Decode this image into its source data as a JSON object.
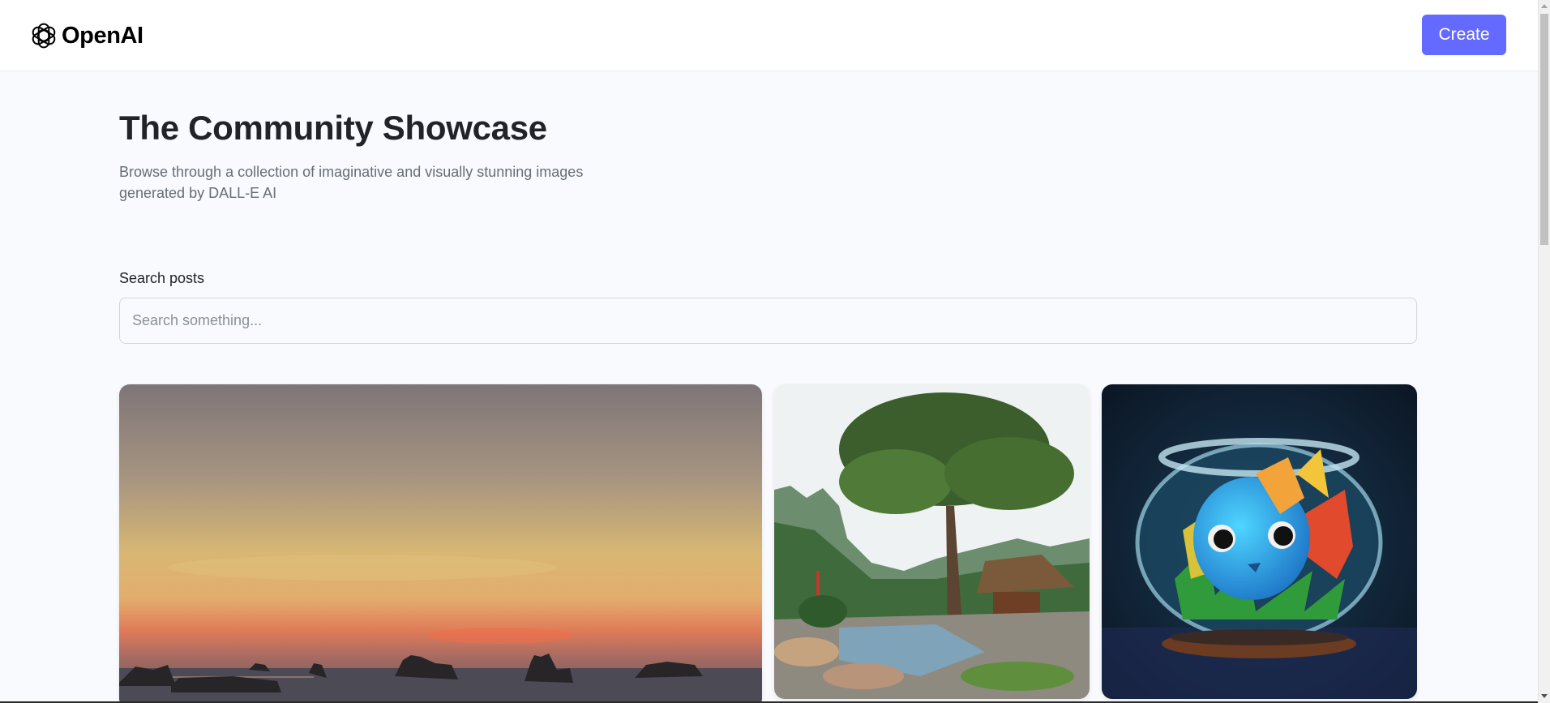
{
  "header": {
    "logo_text": "OpenAI",
    "logo_icon": "openai-logo-icon",
    "create_label": "Create"
  },
  "hero": {
    "title": "The Community Showcase",
    "subtitle": "Browse through a collection of imaginative and visually stunning images generated by DALL-E AI"
  },
  "search": {
    "label": "Search posts",
    "placeholder": "Search something...",
    "value": ""
  },
  "gallery": {
    "posts": [
      {
        "subject": "sunset-over-sea-with-rocks"
      },
      {
        "subject": "treehouse-by-river-and-mountains"
      },
      {
        "subject": "cartoon-fish-in-glass-bowl"
      }
    ]
  },
  "colors": {
    "accent": "#6469ff",
    "title_text": "#222328",
    "muted_text": "#666e75",
    "page_background": "#f9fafe"
  }
}
